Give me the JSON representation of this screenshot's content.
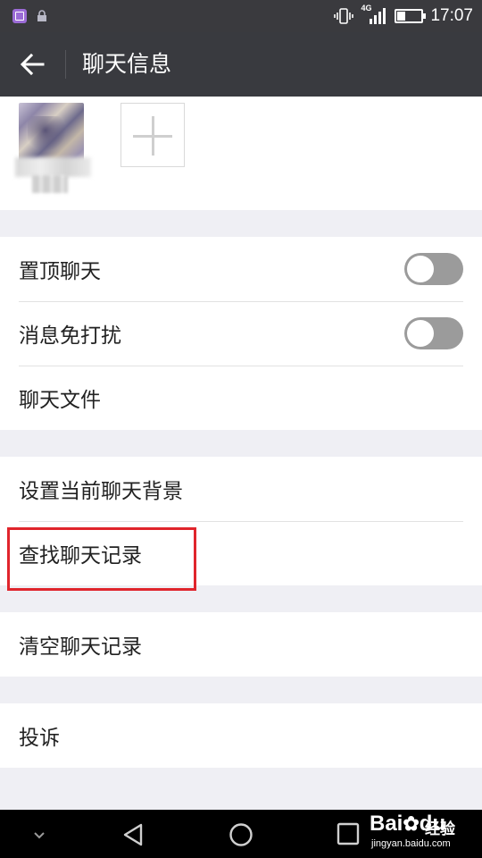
{
  "status_bar": {
    "network": "4G",
    "time": "17:07",
    "battery_level": 0.3,
    "icons": [
      "gallery-notification-icon",
      "lock-icon",
      "vibrate-icon",
      "signal-icon",
      "battery-icon"
    ]
  },
  "app_bar": {
    "title": "聊天信息",
    "back_icon": "arrow-left-icon"
  },
  "groups": [
    {
      "items": [
        {
          "label": "置顶聊天",
          "toggle": false
        },
        {
          "label": "消息免打扰",
          "toggle": false
        },
        {
          "label": "聊天文件"
        }
      ]
    },
    {
      "items": [
        {
          "label": "设置当前聊天背景"
        },
        {
          "label": "查找聊天记录"
        }
      ]
    },
    {
      "items": [
        {
          "label": "清空聊天记录"
        }
      ]
    },
    {
      "items": [
        {
          "label": "投诉"
        }
      ]
    }
  ],
  "nav_bar": {
    "icons": [
      "chevron-down-icon",
      "back-triangle-icon",
      "home-circle-icon",
      "recents-square-icon"
    ]
  },
  "watermark": {
    "logo": "Bai",
    "logo_suffix": "du",
    "product": "经验",
    "url": "jingyan.baidu.com"
  },
  "colors": {
    "app_bar": "#393a3f",
    "background": "#efeff4",
    "highlight": "#e0252c",
    "toggle_off": "#9b9b9b"
  }
}
